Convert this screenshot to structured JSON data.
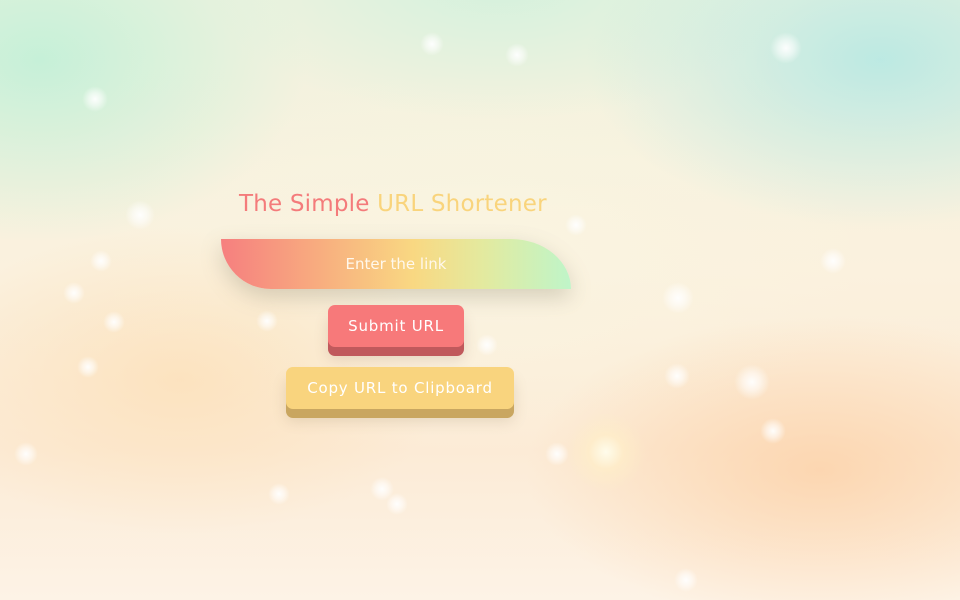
{
  "app": {
    "title_part1": "The Simple",
    "title_part2": "URL Shortener"
  },
  "form": {
    "link_placeholder": "Enter the link",
    "link_value": ""
  },
  "buttons": {
    "submit_label": "Submit URL",
    "copy_label": "Copy URL to Clipboard"
  },
  "colors": {
    "title_primary": "#f47b7b",
    "title_accent": "#f9d47c",
    "submit_button": "#f7797a",
    "copy_button": "#f9d47e",
    "input_gradient": [
      "#f67f7f",
      "#f9d882",
      "#bff5c9"
    ]
  }
}
